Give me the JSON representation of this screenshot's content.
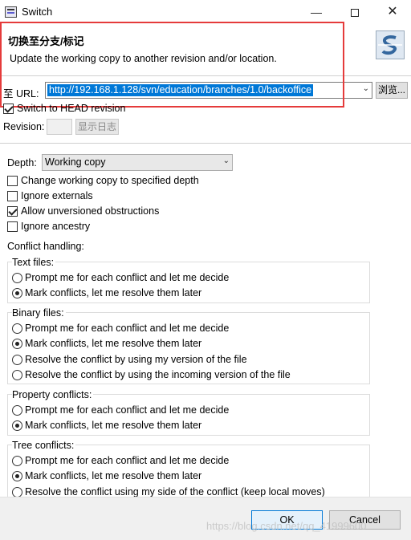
{
  "window": {
    "title": "Switch",
    "app_icon": "svn-app-icon",
    "minimize": "—",
    "close": "✕"
  },
  "header": {
    "title": "切换至分支/标记",
    "description": "Update the working copy to another revision and/or location.",
    "logo_icon": "svn-logo-icon"
  },
  "url": {
    "label": "至 URL:",
    "value": "http://192.168.1.128/svn/education/branches/1.0/backoffice",
    "browse_label": "浏览..."
  },
  "switch_head": {
    "label": "Switch to HEAD revision",
    "checked": true
  },
  "revision": {
    "label": "Revision:",
    "value": "",
    "show_log_label": "显示日志"
  },
  "depth": {
    "label": "Depth:",
    "value": "Working copy"
  },
  "options": {
    "change_depth": {
      "label": "Change working copy to specified depth",
      "checked": false
    },
    "ignore_externals": {
      "label": "Ignore externals",
      "checked": false
    },
    "allow_unversioned": {
      "label": "Allow unversioned obstructions",
      "checked": true
    },
    "ignore_ancestry": {
      "label": "Ignore ancestry",
      "checked": false
    }
  },
  "conflict": {
    "heading": "Conflict handling:",
    "text_files": {
      "label": "Text files:",
      "prompt": "Prompt me for each conflict and let me decide",
      "mark": "Mark conflicts, let me resolve them later",
      "selected": "mark"
    },
    "binary_files": {
      "label": "Binary files:",
      "prompt": "Prompt me for each conflict and let me decide",
      "mark": "Mark conflicts, let me resolve them later",
      "mine": "Resolve the conflict by using my version of the file",
      "incoming": "Resolve the conflict by using the incoming version of the file",
      "selected": "mark"
    },
    "property": {
      "label": "Property conflicts:",
      "prompt": "Prompt me for each conflict and let me decide",
      "mark": "Mark conflicts, let me resolve them later",
      "selected": "mark"
    },
    "tree": {
      "label": "Tree conflicts:",
      "prompt": "Prompt me for each conflict and let me decide",
      "mark": "Mark conflicts, let me resolve them later",
      "mine": "Resolve the conflict using my side of the conflict (keep local moves)",
      "selected": "mark"
    }
  },
  "buttons": {
    "ok": "OK",
    "cancel": "Cancel"
  },
  "watermark": "https://blog.csdn.net/qq_41999600",
  "colors": {
    "selection": "#0078d7",
    "annotation_box": "#e53b3b",
    "ok_border": "#0078d7"
  }
}
